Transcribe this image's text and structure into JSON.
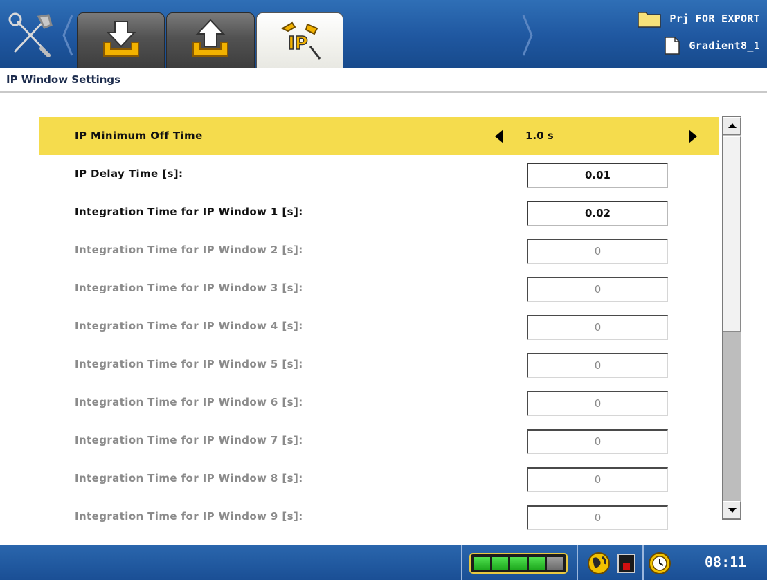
{
  "header": {
    "tabs": [
      {
        "icon": "download-icon",
        "active": false
      },
      {
        "icon": "upload-icon",
        "active": false
      },
      {
        "icon": "ip-settings-icon",
        "active": true
      }
    ],
    "project_name": "Prj FOR EXPORT",
    "file_name": "Gradient8_1"
  },
  "page": {
    "title": "IP Window Settings"
  },
  "settings": {
    "min_off_time": {
      "label": "IP Minimum Off Time",
      "value": "1.0 s"
    },
    "delay_time": {
      "label": "IP Delay Time [s]:",
      "value": "0.01"
    },
    "windows": [
      {
        "label": "Integration Time for IP Window 1 [s]:",
        "value": "0.02",
        "enabled": true
      },
      {
        "label": "Integration Time for IP Window 2 [s]:",
        "value": "0",
        "enabled": false
      },
      {
        "label": "Integration Time for IP Window 3 [s]:",
        "value": "0",
        "enabled": false
      },
      {
        "label": "Integration Time for IP Window 4 [s]:",
        "value": "0",
        "enabled": false
      },
      {
        "label": "Integration Time for IP Window 5 [s]:",
        "value": "0",
        "enabled": false
      },
      {
        "label": "Integration Time for IP Window 6 [s]:",
        "value": "0",
        "enabled": false
      },
      {
        "label": "Integration Time for IP Window 7 [s]:",
        "value": "0",
        "enabled": false
      },
      {
        "label": "Integration Time for IP Window 8 [s]:",
        "value": "0",
        "enabled": false
      },
      {
        "label": "Integration Time for IP Window 9 [s]:",
        "value": "0",
        "enabled": false
      }
    ]
  },
  "status": {
    "battery_cells_filled": 4,
    "battery_cells_total": 5,
    "time": "08:11"
  },
  "colors": {
    "header_blue": "#1f57a0",
    "selected_row": "#f5dc4d",
    "disabled_text": "#8b8b8b"
  }
}
